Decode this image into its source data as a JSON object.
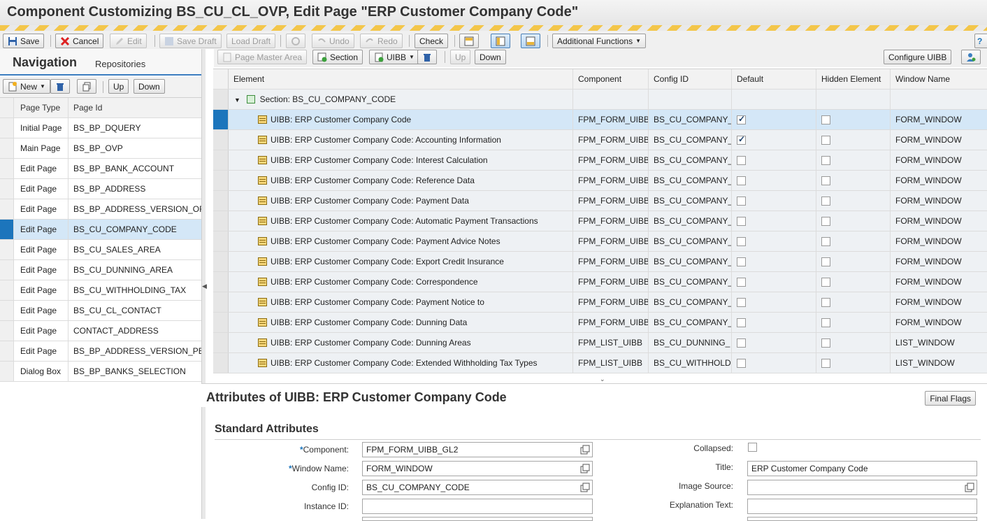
{
  "window": {
    "title": "Component Customizing BS_CU_CL_OVP, Edit Page \"ERP Customer Company Code\""
  },
  "toolbar": {
    "save": "Save",
    "cancel": "Cancel",
    "edit": "Edit",
    "save_draft": "Save Draft",
    "load_draft": "Load Draft",
    "undo": "Undo",
    "redo": "Redo",
    "check": "Check",
    "additional_functions": "Additional Functions"
  },
  "nav": {
    "tab_active": "Navigation",
    "tab_repositories": "Repositories",
    "new": "New",
    "up": "Up",
    "down": "Down",
    "col_page_type": "Page Type",
    "col_page_id": "Page Id",
    "pages": [
      {
        "type": "Initial Page",
        "id": "BS_BP_DQUERY"
      },
      {
        "type": "Main Page",
        "id": "BS_BP_OVP"
      },
      {
        "type": "Edit Page",
        "id": "BS_BP_BANK_ACCOUNT"
      },
      {
        "type": "Edit Page",
        "id": "BS_BP_ADDRESS"
      },
      {
        "type": "Edit Page",
        "id": "BS_BP_ADDRESS_VERSION_OF"
      },
      {
        "type": "Edit Page",
        "id": "BS_CU_COMPANY_CODE"
      },
      {
        "type": "Edit Page",
        "id": "BS_CU_SALES_AREA"
      },
      {
        "type": "Edit Page",
        "id": "BS_CU_DUNNING_AREA"
      },
      {
        "type": "Edit Page",
        "id": "BS_CU_WITHHOLDING_TAX"
      },
      {
        "type": "Edit Page",
        "id": "BS_CU_CL_CONTACT"
      },
      {
        "type": "Edit Page",
        "id": "CONTACT_ADDRESS"
      },
      {
        "type": "Edit Page",
        "id": "BS_BP_ADDRESS_VERSION_PE"
      },
      {
        "type": "Dialog Box",
        "id": "BS_BP_BANKS_SELECTION"
      }
    ]
  },
  "rtoolbar": {
    "page_master_area": "Page Master Area",
    "section": "Section",
    "uibb": "UIBB",
    "up": "Up",
    "down": "Down",
    "configure_uibb": "Configure UIBB"
  },
  "grid": {
    "col_element": "Element",
    "col_component": "Component",
    "col_config": "Config ID",
    "col_default": "Default",
    "col_hidden": "Hidden Element",
    "col_window": "Window Name",
    "section_label": "Section: BS_CU_COMPANY_CODE",
    "rows": [
      {
        "element": "UIBB: ERP Customer Company Code",
        "component": "FPM_FORM_UIBB",
        "config": "BS_CU_COMPANY_",
        "default": true,
        "hidden": false,
        "window": "FORM_WINDOW"
      },
      {
        "element": "UIBB: ERP Customer Company Code: Accounting Information",
        "component": "FPM_FORM_UIBB",
        "config": "BS_CU_COMPANY_",
        "default": true,
        "hidden": false,
        "window": "FORM_WINDOW"
      },
      {
        "element": "UIBB: ERP Customer Company Code: Interest Calculation",
        "component": "FPM_FORM_UIBB",
        "config": "BS_CU_COMPANY_",
        "default": false,
        "hidden": false,
        "window": "FORM_WINDOW"
      },
      {
        "element": "UIBB: ERP Customer Company Code: Reference Data",
        "component": "FPM_FORM_UIBB",
        "config": "BS_CU_COMPANY_",
        "default": false,
        "hidden": false,
        "window": "FORM_WINDOW"
      },
      {
        "element": "UIBB: ERP Customer Company Code: Payment Data",
        "component": "FPM_FORM_UIBB",
        "config": "BS_CU_COMPANY_",
        "default": false,
        "hidden": false,
        "window": "FORM_WINDOW"
      },
      {
        "element": "UIBB: ERP Customer Company Code: Automatic Payment Transactions",
        "component": "FPM_FORM_UIBB",
        "config": "BS_CU_COMPANY_",
        "default": false,
        "hidden": false,
        "window": "FORM_WINDOW"
      },
      {
        "element": "UIBB: ERP Customer Company Code: Payment Advice Notes",
        "component": "FPM_FORM_UIBB",
        "config": "BS_CU_COMPANY_",
        "default": false,
        "hidden": false,
        "window": "FORM_WINDOW"
      },
      {
        "element": "UIBB: ERP Customer Company Code: Export Credit Insurance",
        "component": "FPM_FORM_UIBB",
        "config": "BS_CU_COMPANY_",
        "default": false,
        "hidden": false,
        "window": "FORM_WINDOW"
      },
      {
        "element": "UIBB: ERP Customer Company Code: Correspondence",
        "component": "FPM_FORM_UIBB",
        "config": "BS_CU_COMPANY_",
        "default": false,
        "hidden": false,
        "window": "FORM_WINDOW"
      },
      {
        "element": "UIBB: ERP Customer Company Code: Payment Notice to",
        "component": "FPM_FORM_UIBB",
        "config": "BS_CU_COMPANY_",
        "default": false,
        "hidden": false,
        "window": "FORM_WINDOW"
      },
      {
        "element": "UIBB: ERP Customer Company Code: Dunning Data",
        "component": "FPM_FORM_UIBB",
        "config": "BS_CU_COMPANY_",
        "default": false,
        "hidden": false,
        "window": "FORM_WINDOW"
      },
      {
        "element": "UIBB: ERP Customer Company Code: Dunning Areas",
        "component": "FPM_LIST_UIBB",
        "config": "BS_CU_DUNNING_",
        "default": false,
        "hidden": false,
        "window": "LIST_WINDOW"
      },
      {
        "element": "UIBB: ERP Customer Company Code: Extended Withholding Tax Types",
        "component": "FPM_LIST_UIBB",
        "config": "BS_CU_WITHHOLD",
        "default": false,
        "hidden": false,
        "window": "LIST_WINDOW"
      }
    ]
  },
  "attributes": {
    "title": "Attributes of UIBB: ERP Customer Company Code",
    "final_flags": "Final Flags",
    "standard": "Standard Attributes",
    "component_label": "Component:",
    "component_value": "FPM_FORM_UIBB_GL2",
    "window_label": "Window Name:",
    "window_value": "FORM_WINDOW",
    "config_label": "Config ID:",
    "config_value": "BS_CU_COMPANY_CODE",
    "instance_label": "Instance ID:",
    "instance_value": "",
    "collapsed_label": "Collapsed:",
    "title_label": "Title:",
    "title_value": "ERP Customer Company Code",
    "image_label": "Image Source:",
    "image_value": "",
    "explanation_label": "Explanation Text:",
    "explanation_value": ""
  },
  "colors": {
    "accent": "#1c75bc",
    "selected_row": "#d4e7f7",
    "warning_stripe": "#f3c64a"
  }
}
